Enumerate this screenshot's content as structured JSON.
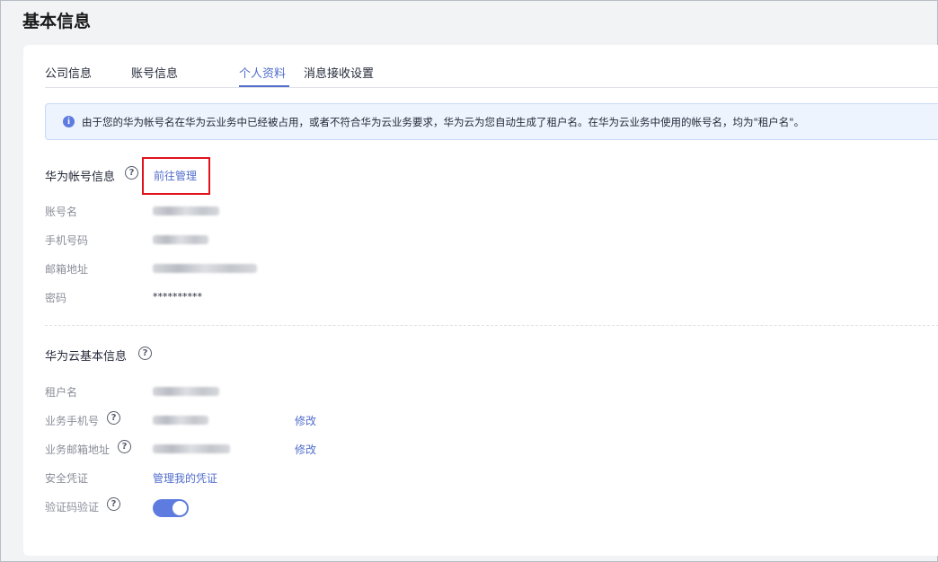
{
  "page": {
    "title": "基本信息"
  },
  "tabs": [
    {
      "label": "公司信息"
    },
    {
      "label": "账号信息"
    },
    {
      "label": "个人资料"
    },
    {
      "label": "消息接收设置"
    }
  ],
  "notice": {
    "icon": "info-icon",
    "text": "由于您的华为帐号名在华为云业务中已经被占用，或者不符合华为云业务要求，华为云为您自动生成了租户名。在华为云业务中使用的帐号名，均为\"租户名\"。"
  },
  "huawei_account": {
    "title": "华为帐号信息",
    "manage_link": "前往管理",
    "fields": [
      {
        "label": "账号名"
      },
      {
        "label": "手机号码"
      },
      {
        "label": "邮箱地址"
      },
      {
        "label": "密码",
        "value": "**********"
      }
    ]
  },
  "cloud_info": {
    "title": "华为云基本信息",
    "fields": [
      {
        "label": "租户名"
      },
      {
        "label": "业务手机号",
        "action": "修改"
      },
      {
        "label": "业务邮箱地址",
        "action": "修改"
      },
      {
        "label": "安全凭证",
        "link": "管理我的凭证"
      },
      {
        "label": "验证码验证",
        "toggle_on": true
      }
    ]
  },
  "colors": {
    "accent": "#526ecc",
    "highlight": "#e0121c",
    "toggle": "#5e7ce0"
  }
}
